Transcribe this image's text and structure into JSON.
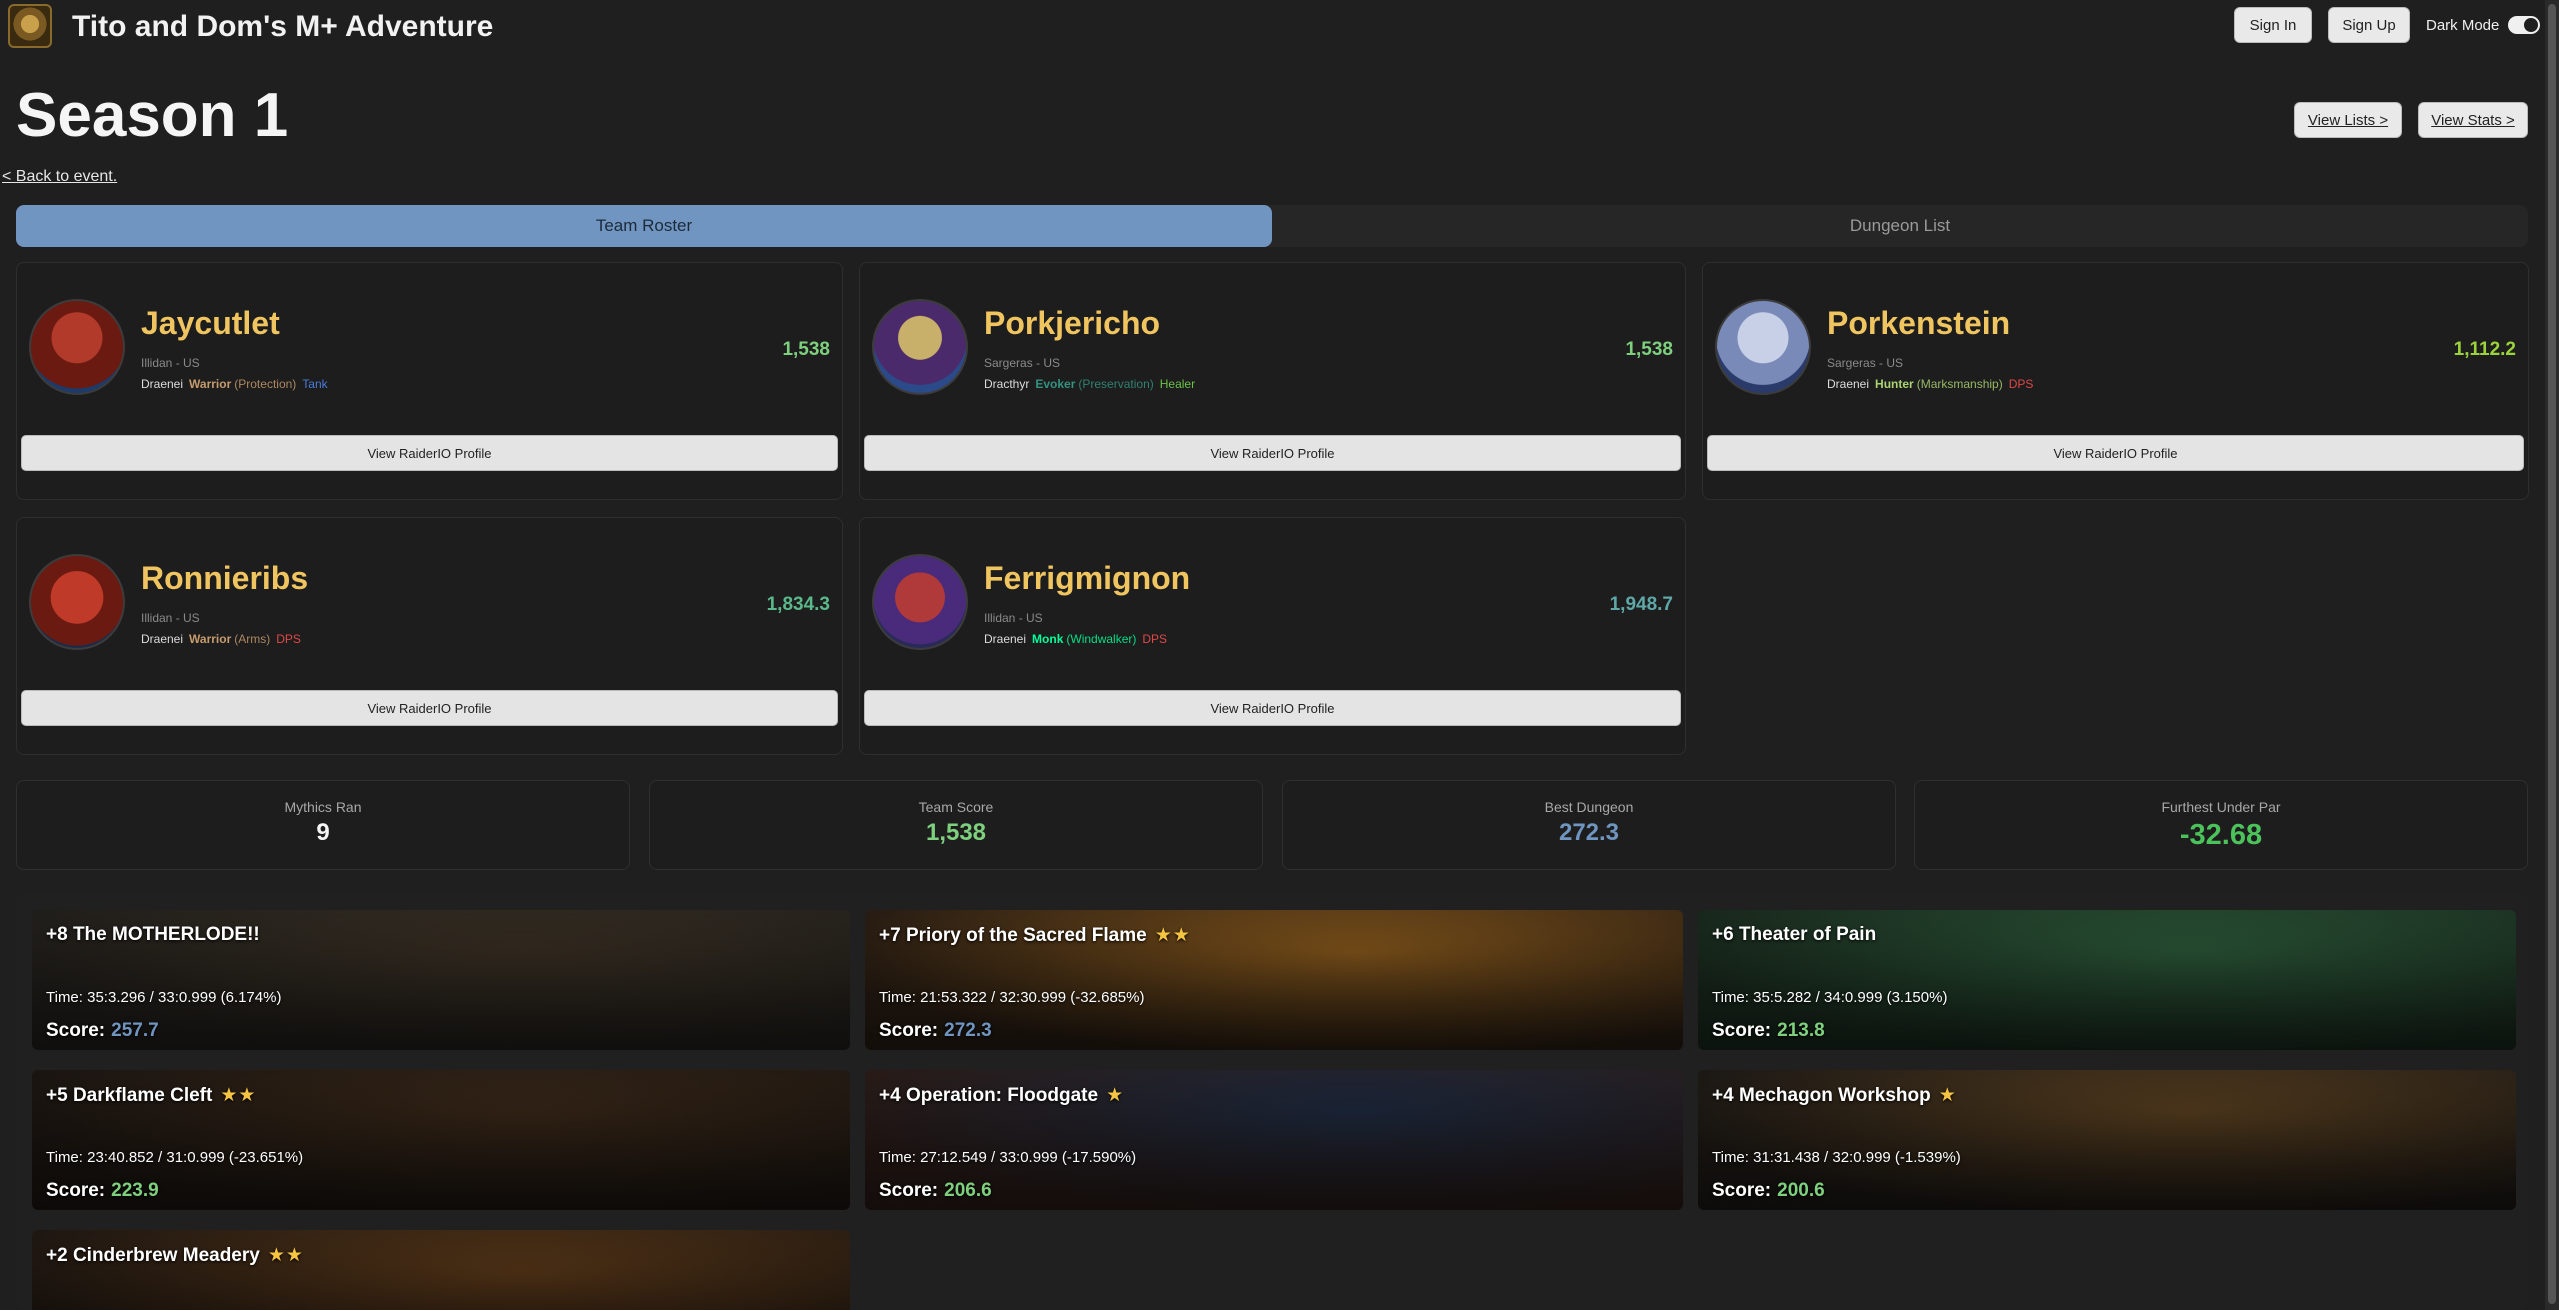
{
  "header": {
    "title": "Tito and Dom's M+ Adventure",
    "sign_in": "Sign In",
    "sign_up": "Sign Up",
    "dark_mode_label": "Dark Mode",
    "dark_mode_on": true
  },
  "page": {
    "title": "Season 1",
    "view_lists": "View Lists >",
    "view_stats": "View Stats >",
    "back": "< Back to event."
  },
  "tabs": [
    {
      "label": "Team Roster",
      "active": true
    },
    {
      "label": "Dungeon List",
      "active": false
    }
  ],
  "roster": [
    {
      "name": "Jaycutlet",
      "realm": "Illidan - US",
      "race": "Draenei",
      "class": "Warrior",
      "spec": "(Protection)",
      "role": "Tank",
      "score": "1,538",
      "class_color": "#c69b6d",
      "role_color": "#4a7bd8",
      "score_color": "#7ed07e",
      "button": "View RaiderIO Profile"
    },
    {
      "name": "Porkjericho",
      "realm": "Sargeras - US",
      "race": "Dracthyr",
      "class": "Evoker",
      "spec": "(Preservation)",
      "role": "Healer",
      "score": "1,538",
      "class_color": "#33937f",
      "role_color": "#6cc24a",
      "score_color": "#7ed07e",
      "button": "View RaiderIO Profile"
    },
    {
      "name": "Porkenstein",
      "realm": "Sargeras - US",
      "race": "Draenei",
      "class": "Hunter",
      "spec": "(Marksmanship)",
      "role": "DPS",
      "score": "1,112.2",
      "class_color": "#aad372",
      "role_color": "#e04848",
      "score_color": "#9bd43a",
      "button": "View RaiderIO Profile"
    },
    {
      "name": "Ronnieribs",
      "realm": "Illidan - US",
      "race": "Draenei",
      "class": "Warrior",
      "spec": "(Arms)",
      "role": "DPS",
      "score": "1,834.3",
      "class_color": "#c69b6d",
      "role_color": "#e04848",
      "score_color": "#5ab88a",
      "button": "View RaiderIO Profile"
    },
    {
      "name": "Ferrigmignon",
      "realm": "Illidan - US",
      "race": "Draenei",
      "class": "Monk",
      "spec": "(Windwalker)",
      "role": "DPS",
      "score": "1,948.7",
      "class_color": "#00ff98",
      "role_color": "#e04848",
      "score_color": "#5fa8a8",
      "button": "View RaiderIO Profile"
    }
  ],
  "stats": [
    {
      "label": "Mythics Ran",
      "value": "9",
      "color": "#f5f5f5"
    },
    {
      "label": "Team Score",
      "value": "1,538",
      "color": "#7ed07e"
    },
    {
      "label": "Best Dungeon",
      "value": "272.3",
      "color": "#6f95c0"
    },
    {
      "label": "Furthest Under Par",
      "value": "-32.68",
      "color": "#4cc25a"
    }
  ],
  "runs": [
    {
      "title": "+8 The MOTHERLODE!!",
      "stars": "",
      "time_label": "Time:",
      "time": "35:3.296 / 33:0.999 (6.174%)",
      "score_label": "Score:",
      "score": "257.7",
      "score_color": "#6f95c0",
      "bg": [
        "#3a3024",
        "#22201c"
      ]
    },
    {
      "title": "+7 Priory of the Sacred Flame",
      "stars": "★★",
      "time_label": "Time:",
      "time": "21:53.322 / 32:30.999 (-32.685%)",
      "score_label": "Score:",
      "score": "272.3",
      "score_color": "#6f95c0",
      "bg": [
        "#8a5a1c",
        "#2a1e14"
      ]
    },
    {
      "title": "+6 Theater of Pain",
      "stars": "",
      "time_label": "Time:",
      "time": "35:5.282 / 34:0.999 (3.150%)",
      "score_label": "Score:",
      "score": "213.8",
      "score_color": "#7ed07e",
      "bg": [
        "#2c5a3a",
        "#1a2a1e"
      ]
    },
    {
      "title": "+5 Darkflame Cleft",
      "stars": "★★",
      "time_label": "Time:",
      "time": "23:40.852 / 31:0.999 (-23.651%)",
      "score_label": "Score:",
      "score": "223.9",
      "score_color": "#7ed07e",
      "bg": [
        "#3a2818",
        "#1c1612"
      ]
    },
    {
      "title": "+4 Operation: Floodgate",
      "stars": "★",
      "time_label": "Time:",
      "time": "27:12.549 / 33:0.999 (-17.590%)",
      "score_label": "Score:",
      "score": "206.6",
      "score_color": "#7ed07e",
      "bg": [
        "#1e2a40",
        "#2a1c18"
      ]
    },
    {
      "title": "+4 Mechagon Workshop",
      "stars": "★",
      "time_label": "Time:",
      "time": "31:31.438 / 32:0.999 (-1.539%)",
      "score_label": "Score:",
      "score": "200.6",
      "score_color": "#7ed07e",
      "bg": [
        "#5a4020",
        "#1e1a16"
      ]
    },
    {
      "title": "+2 Cinderbrew Meadery",
      "stars": "★★",
      "time_label": "",
      "time": "",
      "score_label": "",
      "score": "",
      "score_color": "#7ed07e",
      "bg": [
        "#5a3818",
        "#201812"
      ]
    }
  ]
}
